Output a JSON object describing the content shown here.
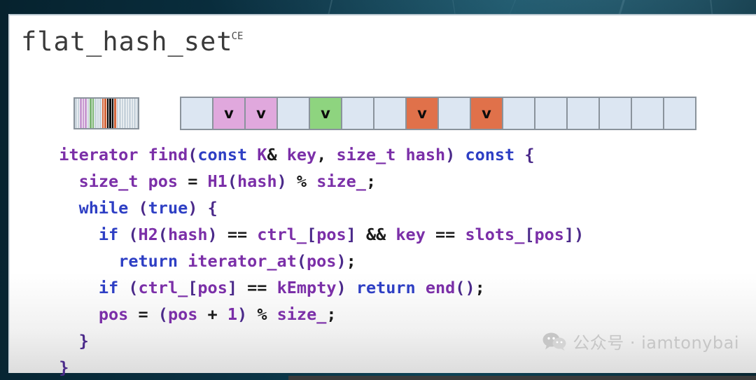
{
  "slide": {
    "title": "flat_hash_set",
    "title_superscript": "CE",
    "colors": {
      "keyword": "#2e3fc4",
      "identifier": "#7b2fa8",
      "operator": "#1a1a1a",
      "slot_empty": "#dce6f2",
      "slot_purple": "#e0a8dd",
      "slot_green": "#8ed47f",
      "slot_orange": "#e0714a",
      "slot_border": "#8a939c",
      "backdrop_teal": "#0d4356"
    }
  },
  "diagram": {
    "control_bytes_label": "control-bytes-block",
    "control_stripes": [
      "#c9d4dd",
      "#c9d4dd",
      "#c79ad1",
      "#c79ad1",
      "#c79ad1",
      "#c9d4dd",
      "#7cb473",
      "#7cb473",
      "#c9d4dd",
      "#c9d4dd",
      "#c9d4dd",
      "#d4663c",
      "#d4663c",
      "#0a0a0a",
      "#0a0a0a",
      "#0a0a0a",
      "#d4663c",
      "#c9d4dd",
      "#c9d4dd",
      "#c9d4dd",
      "#c9d4dd",
      "#c9d4dd",
      "#c9d4dd",
      "#c9d4dd",
      "#c9d4dd",
      "#c9d4dd"
    ],
    "slots": [
      {
        "mark": "",
        "fill": "#dce6f2"
      },
      {
        "mark": "v",
        "fill": "#e0a8dd"
      },
      {
        "mark": "v",
        "fill": "#e0a8dd"
      },
      {
        "mark": "",
        "fill": "#dce6f2"
      },
      {
        "mark": "v",
        "fill": "#8ed47f"
      },
      {
        "mark": "",
        "fill": "#dce6f2"
      },
      {
        "mark": "",
        "fill": "#dce6f2"
      },
      {
        "mark": "v",
        "fill": "#e0714a"
      },
      {
        "mark": "",
        "fill": "#dce6f2"
      },
      {
        "mark": "v",
        "fill": "#e0714a"
      },
      {
        "mark": "",
        "fill": "#dce6f2"
      },
      {
        "mark": "",
        "fill": "#dce6f2"
      },
      {
        "mark": "",
        "fill": "#dce6f2"
      },
      {
        "mark": "",
        "fill": "#dce6f2"
      },
      {
        "mark": "",
        "fill": "#dce6f2"
      },
      {
        "mark": "",
        "fill": "#dce6f2"
      }
    ]
  },
  "code": {
    "language": "cpp",
    "lines": [
      [
        {
          "t": "  iterator find",
          "c": "id"
        },
        {
          "t": "(",
          "c": "pn"
        },
        {
          "t": "const",
          "c": "kw"
        },
        {
          "t": " K",
          "c": "id"
        },
        {
          "t": "&",
          "c": "op"
        },
        {
          "t": " key",
          "c": "id"
        },
        {
          "t": ",",
          "c": "op"
        },
        {
          "t": " size_t hash",
          "c": "id"
        },
        {
          "t": ")",
          "c": "pn"
        },
        {
          "t": " ",
          "c": "id"
        },
        {
          "t": "const",
          "c": "kw"
        },
        {
          "t": " ",
          "c": "id"
        },
        {
          "t": "{",
          "c": "pn"
        }
      ],
      [
        {
          "t": "    size_t pos ",
          "c": "id"
        },
        {
          "t": "=",
          "c": "op"
        },
        {
          "t": " H1",
          "c": "id"
        },
        {
          "t": "(",
          "c": "pn"
        },
        {
          "t": "hash",
          "c": "id"
        },
        {
          "t": ")",
          "c": "pn"
        },
        {
          "t": " % ",
          "c": "op"
        },
        {
          "t": "size_",
          "c": "id"
        },
        {
          "t": ";",
          "c": "op"
        }
      ],
      [
        {
          "t": "    ",
          "c": "id"
        },
        {
          "t": "while",
          "c": "kw"
        },
        {
          "t": " ",
          "c": "id"
        },
        {
          "t": "(",
          "c": "pn"
        },
        {
          "t": "true",
          "c": "kw"
        },
        {
          "t": ")",
          "c": "pn"
        },
        {
          "t": " ",
          "c": "id"
        },
        {
          "t": "{",
          "c": "pn"
        }
      ],
      [
        {
          "t": "      ",
          "c": "id"
        },
        {
          "t": "if",
          "c": "kw"
        },
        {
          "t": " ",
          "c": "id"
        },
        {
          "t": "(",
          "c": "pn"
        },
        {
          "t": "H2",
          "c": "id"
        },
        {
          "t": "(",
          "c": "pn"
        },
        {
          "t": "hash",
          "c": "id"
        },
        {
          "t": ")",
          "c": "pn"
        },
        {
          "t": " == ",
          "c": "op"
        },
        {
          "t": "ctrl_",
          "c": "id"
        },
        {
          "t": "[",
          "c": "pn"
        },
        {
          "t": "pos",
          "c": "id"
        },
        {
          "t": "]",
          "c": "pn"
        },
        {
          "t": " && ",
          "c": "op"
        },
        {
          "t": "key",
          "c": "id"
        },
        {
          "t": " == ",
          "c": "op"
        },
        {
          "t": "slots_",
          "c": "id"
        },
        {
          "t": "[",
          "c": "pn"
        },
        {
          "t": "pos",
          "c": "id"
        },
        {
          "t": "])",
          "c": "pn"
        }
      ],
      [
        {
          "t": "        ",
          "c": "id"
        },
        {
          "t": "return",
          "c": "kw"
        },
        {
          "t": " iterator_at",
          "c": "id"
        },
        {
          "t": "(",
          "c": "pn"
        },
        {
          "t": "pos",
          "c": "id"
        },
        {
          "t": ")",
          "c": "pn"
        },
        {
          "t": ";",
          "c": "op"
        }
      ],
      [
        {
          "t": "      ",
          "c": "id"
        },
        {
          "t": "if",
          "c": "kw"
        },
        {
          "t": " ",
          "c": "id"
        },
        {
          "t": "(",
          "c": "pn"
        },
        {
          "t": "ctrl_",
          "c": "id"
        },
        {
          "t": "[",
          "c": "pn"
        },
        {
          "t": "pos",
          "c": "id"
        },
        {
          "t": "]",
          "c": "pn"
        },
        {
          "t": " == ",
          "c": "op"
        },
        {
          "t": "kEmpty",
          "c": "id"
        },
        {
          "t": ")",
          "c": "pn"
        },
        {
          "t": " ",
          "c": "id"
        },
        {
          "t": "return",
          "c": "kw"
        },
        {
          "t": " end",
          "c": "id"
        },
        {
          "t": "()",
          "c": "pn"
        },
        {
          "t": ";",
          "c": "op"
        }
      ],
      [
        {
          "t": "      pos ",
          "c": "id"
        },
        {
          "t": "=",
          "c": "op"
        },
        {
          "t": " ",
          "c": "id"
        },
        {
          "t": "(",
          "c": "pn"
        },
        {
          "t": "pos",
          "c": "id"
        },
        {
          "t": " + ",
          "c": "op"
        },
        {
          "t": "1",
          "c": "id"
        },
        {
          "t": ")",
          "c": "pn"
        },
        {
          "t": " % ",
          "c": "op"
        },
        {
          "t": "size_",
          "c": "id"
        },
        {
          "t": ";",
          "c": "op"
        }
      ],
      [
        {
          "t": "    ",
          "c": "id"
        },
        {
          "t": "}",
          "c": "pn"
        }
      ],
      [
        {
          "t": "  ",
          "c": "id"
        },
        {
          "t": "}",
          "c": "pn"
        }
      ]
    ]
  },
  "watermark": {
    "icon": "wechat-icon",
    "text": "公众号 · iamtonybai"
  },
  "player": {
    "progress_percent": 0
  }
}
